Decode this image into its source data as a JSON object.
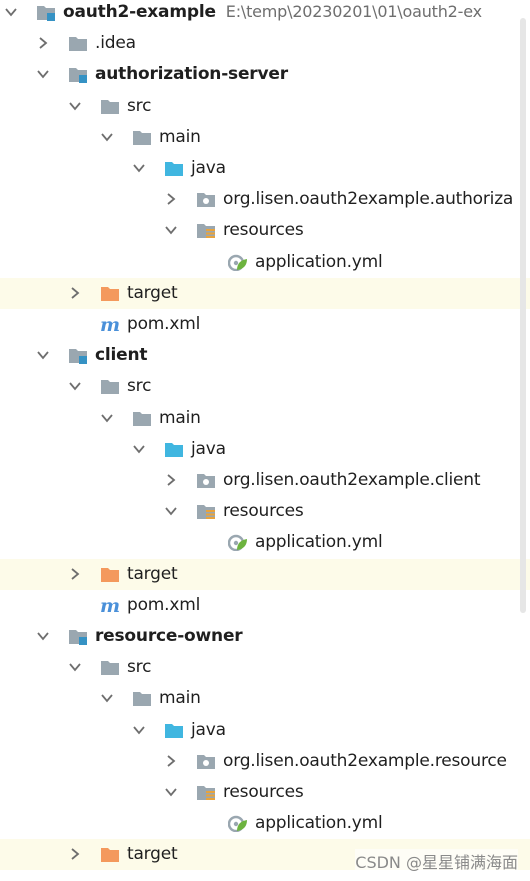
{
  "project_tree": [
    {
      "label": "oauth2-example",
      "path": "E:\\temp\\20230201\\01\\oauth2-ex",
      "icon": "module-folder-icon",
      "chevron": "down",
      "bold": true
    },
    {
      "label": ".idea",
      "icon": "folder-icon",
      "chevron": "right"
    },
    {
      "label": "authorization-server",
      "icon": "module-folder-icon",
      "chevron": "down",
      "bold": true
    },
    {
      "label": "src",
      "icon": "folder-icon",
      "chevron": "down"
    },
    {
      "label": "main",
      "icon": "folder-icon",
      "chevron": "down"
    },
    {
      "label": "java",
      "icon": "source-folder-icon",
      "chevron": "down"
    },
    {
      "label": "org.lisen.oauth2example.authoriza",
      "icon": "package-icon",
      "chevron": "right"
    },
    {
      "label": "resources",
      "icon": "resources-folder-icon",
      "chevron": "down"
    },
    {
      "label": "application.yml",
      "icon": "spring-config-icon"
    },
    {
      "label": "target",
      "icon": "excluded-folder-icon",
      "chevron": "right",
      "highlight": true
    },
    {
      "label": "pom.xml",
      "icon": "maven-icon"
    },
    {
      "label": "client",
      "icon": "module-folder-icon",
      "chevron": "down",
      "bold": true
    },
    {
      "label": "src",
      "icon": "folder-icon",
      "chevron": "down"
    },
    {
      "label": "main",
      "icon": "folder-icon",
      "chevron": "down"
    },
    {
      "label": "java",
      "icon": "source-folder-icon",
      "chevron": "down"
    },
    {
      "label": "org.lisen.oauth2example.client",
      "icon": "package-icon",
      "chevron": "right"
    },
    {
      "label": "resources",
      "icon": "resources-folder-icon",
      "chevron": "down"
    },
    {
      "label": "application.yml",
      "icon": "spring-config-icon"
    },
    {
      "label": "target",
      "icon": "excluded-folder-icon",
      "chevron": "right",
      "highlight": true
    },
    {
      "label": "pom.xml",
      "icon": "maven-icon"
    },
    {
      "label": "resource-owner",
      "icon": "module-folder-icon",
      "chevron": "down",
      "bold": true
    },
    {
      "label": "src",
      "icon": "folder-icon",
      "chevron": "down"
    },
    {
      "label": "main",
      "icon": "folder-icon",
      "chevron": "down"
    },
    {
      "label": "java",
      "icon": "source-folder-icon",
      "chevron": "down"
    },
    {
      "label": "org.lisen.oauth2example.resource",
      "icon": "package-icon",
      "chevron": "right"
    },
    {
      "label": "resources",
      "icon": "resources-folder-icon",
      "chevron": "down"
    },
    {
      "label": "application.yml",
      "icon": "spring-config-icon"
    },
    {
      "label": "target",
      "icon": "excluded-folder-icon",
      "chevron": "right",
      "highlight": true
    }
  ],
  "watermark": "CSDN @星星铺满海面",
  "colors": {
    "folder": "#9aa7b0",
    "module_badge": "#3592c4",
    "source_folder": "#40b6e0",
    "excluded_folder": "#f4995d",
    "spring": "#6db33f",
    "maven": "#4a90d9",
    "resources_stripes": "#e8a33c",
    "highlight_row": "#fdfbe9"
  }
}
